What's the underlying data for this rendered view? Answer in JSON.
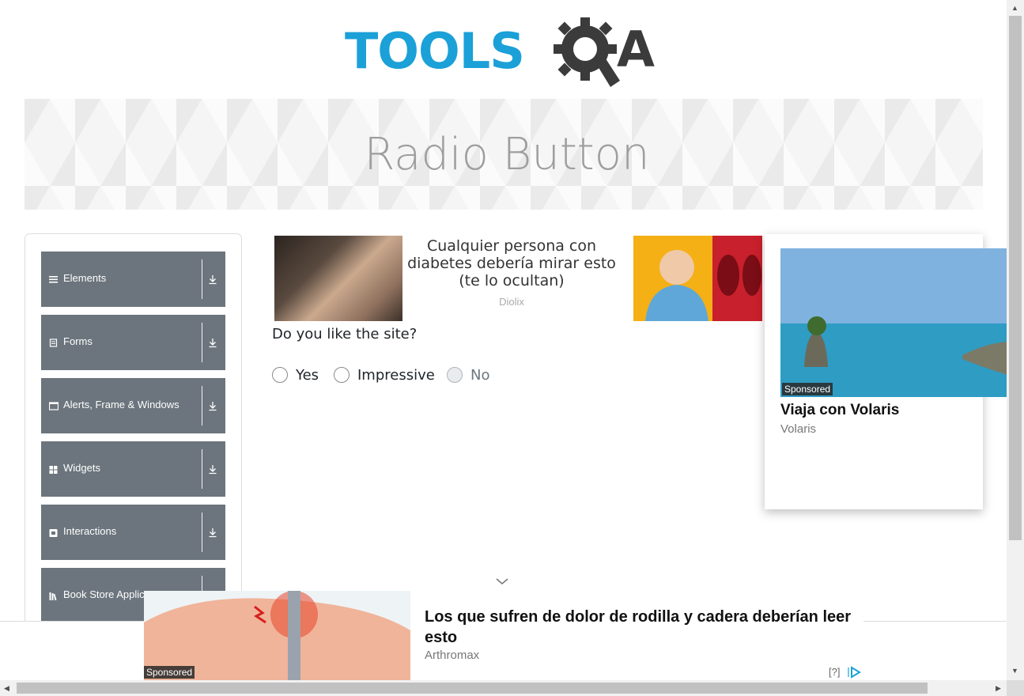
{
  "logo": {
    "text": "TOOLS",
    "suffix": "A"
  },
  "banner": {
    "title": "Radio Button"
  },
  "sidebar": {
    "groups": [
      {
        "label": "Elements",
        "icon": "list-icon"
      },
      {
        "label": "Forms",
        "icon": "form-icon"
      },
      {
        "label": "Alerts, Frame & Windows",
        "icon": "window-icon"
      },
      {
        "label": "Widgets",
        "icon": "widgets-icon"
      },
      {
        "label": "Interactions",
        "icon": "interactions-icon"
      },
      {
        "label": "Book Store Applicat",
        "icon": "books-icon"
      }
    ]
  },
  "top_ad": {
    "headline": "Cualquier persona con diabetes debería mirar esto (te lo ocultan)",
    "brand": "Diolix"
  },
  "question": "Do you like the site?",
  "radios": [
    {
      "label": "Yes",
      "disabled": false
    },
    {
      "label": "Impressive",
      "disabled": false
    },
    {
      "label": "No",
      "disabled": true
    }
  ],
  "side_ad": {
    "sponsored": "Sponsored",
    "title": "Viaja con Volaris",
    "brand": "Volaris"
  },
  "bottom_ad": {
    "sponsored": "Sponsored",
    "title": "Los que sufren de dolor de rodilla y cadera deberían leer esto",
    "brand": "Arthromax",
    "help": "[?]"
  },
  "colors": {
    "brand_blue": "#1ba0d8",
    "sidebar_group": "#6c757d",
    "banner_title": "#9e9e9e"
  }
}
